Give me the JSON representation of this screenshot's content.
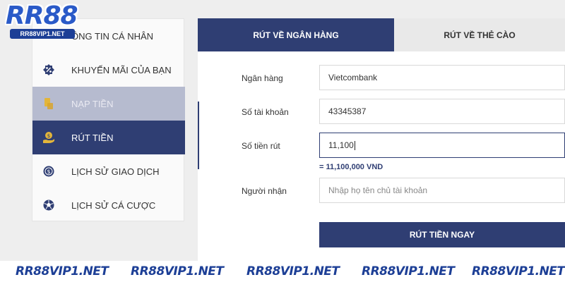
{
  "logo": {
    "title": "RR88",
    "subtitle": "RR88VIP1.NET"
  },
  "sidebar": {
    "items": [
      {
        "label": "ÔNG TIN CÁ NHÂN",
        "icon": "user-icon"
      },
      {
        "label": "KHUYẾN MÃI CỦA BẠN",
        "icon": "discount-badge-icon"
      },
      {
        "label": "NẠP TIỀN",
        "icon": "deposit-icon"
      },
      {
        "label": "RÚT TIỀN",
        "icon": "withdraw-hand-coin-icon"
      },
      {
        "label": "LỊCH SỬ GIAO DỊCH",
        "icon": "dollar-coin-icon"
      },
      {
        "label": "LỊCH SỬ CÁ CƯỢC",
        "icon": "soccer-ball-icon"
      }
    ],
    "hover_index": 2,
    "active_index": 3
  },
  "tabs": [
    {
      "label": "RÚT VỀ NGÂN HÀNG",
      "active": true
    },
    {
      "label": "RÚT VỀ THẺ CÀO",
      "active": false
    }
  ],
  "form": {
    "bank": {
      "label": "Ngân hàng",
      "value": "Vietcombank"
    },
    "account": {
      "label": "Số tài khoản",
      "value": "43345387"
    },
    "amount": {
      "label": "Số tiền rút",
      "value": "11,100",
      "hint": "= 11,100,000 VND"
    },
    "recipient": {
      "label": "Người nhận",
      "placeholder": "Nhập họ tên chủ tài khoản"
    },
    "submit_label": "RÚT TIỀN NGAY"
  },
  "footer": {
    "items": [
      "RR88VIP1.NET",
      "RR88VIP1.NET",
      "RR88VIP1.NET",
      "RR88VIP1.NET",
      "RR88VIP1.NET"
    ]
  },
  "colors": {
    "primary": "#2f3e73",
    "hover": "#b6bbcf",
    "icon_gold": "#e3b53a"
  }
}
